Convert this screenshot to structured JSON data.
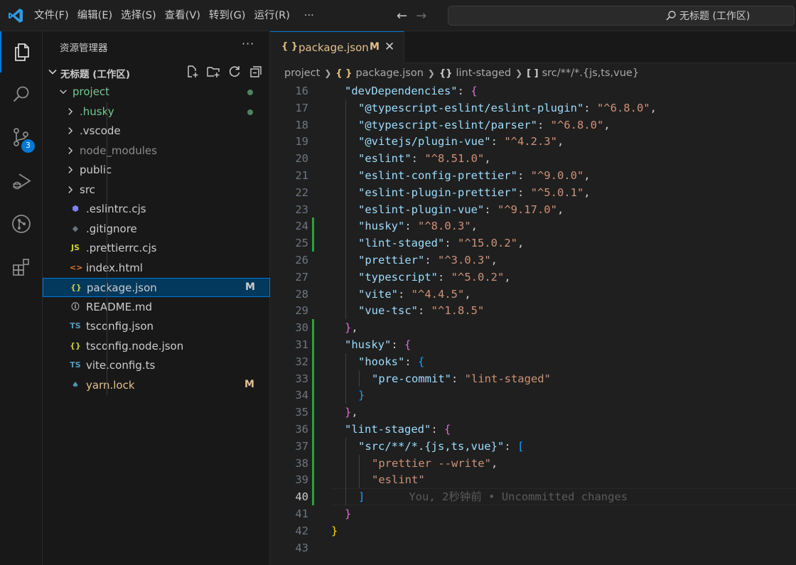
{
  "menu": {
    "items": [
      "文件(F)",
      "编辑(E)",
      "选择(S)",
      "查看(V)",
      "转到(G)",
      "运行(R)",
      "···"
    ],
    "search_text": "无标题 (工作区)"
  },
  "activity": {
    "scm_badge": "3"
  },
  "sidebar": {
    "title": "资源管理器",
    "more": "···",
    "workspace": "无标题 (工作区)",
    "tree": [
      {
        "label": "project",
        "type": "folder-open",
        "indent": 0,
        "color": "#73c991",
        "dot": true
      },
      {
        "label": ".husky",
        "type": "folder",
        "indent": 1,
        "color": "#73c991",
        "dot": true
      },
      {
        "label": ".vscode",
        "type": "folder",
        "indent": 1,
        "color": "#cccccc"
      },
      {
        "label": "node_modules",
        "type": "folder",
        "indent": 1,
        "color": "#8c8c8c"
      },
      {
        "label": "public",
        "type": "folder",
        "indent": 1,
        "color": "#cccccc"
      },
      {
        "label": "src",
        "type": "folder",
        "indent": 1,
        "color": "#cccccc"
      },
      {
        "label": ".eslintrc.cjs",
        "type": "file",
        "indent": 1,
        "icon": "eslint",
        "color": "#cccccc"
      },
      {
        "label": ".gitignore",
        "type": "file",
        "indent": 1,
        "icon": "git",
        "color": "#cccccc"
      },
      {
        "label": ".prettierrc.cjs",
        "type": "file",
        "indent": 1,
        "icon": "js",
        "color": "#cccccc"
      },
      {
        "label": "index.html",
        "type": "file",
        "indent": 1,
        "icon": "html",
        "color": "#cccccc"
      },
      {
        "label": "package.json",
        "type": "file",
        "indent": 1,
        "icon": "json",
        "color": "#cccccc",
        "status": "M",
        "selected": true
      },
      {
        "label": "README.md",
        "type": "file",
        "indent": 1,
        "icon": "info",
        "color": "#cccccc"
      },
      {
        "label": "tsconfig.json",
        "type": "file",
        "indent": 1,
        "icon": "tsconfig",
        "color": "#cccccc"
      },
      {
        "label": "tsconfig.node.json",
        "type": "file",
        "indent": 1,
        "icon": "json",
        "color": "#cccccc"
      },
      {
        "label": "vite.config.ts",
        "type": "file",
        "indent": 1,
        "icon": "ts",
        "color": "#cccccc"
      },
      {
        "label": "yarn.lock",
        "type": "file",
        "indent": 1,
        "icon": "yarn",
        "color": "#e2c08d",
        "status": "M"
      }
    ]
  },
  "editor": {
    "tab": {
      "label": "package.json",
      "status": "M",
      "close": "✕",
      "icon": "{ }"
    },
    "breadcrumb": {
      "project": "project",
      "file": "package.json",
      "obj": "lint-staged",
      "arr": "src/**/*.{js,ts,vue}"
    },
    "current_line": 40,
    "blame": "You, 2秒钟前 • Uncommitted changes",
    "modified_lines": [
      24,
      25,
      30,
      31,
      32,
      33,
      34,
      35,
      36,
      37,
      38,
      39,
      40
    ],
    "lines": [
      {
        "n": 16,
        "indent": 1,
        "tokens": [
          [
            "k",
            "\"devDependencies\""
          ],
          [
            "p",
            ": "
          ],
          [
            "b1",
            "{"
          ]
        ]
      },
      {
        "n": 17,
        "indent": 2,
        "tokens": [
          [
            "k",
            "\"@typescript-eslint/eslint-plugin\""
          ],
          [
            "p",
            ": "
          ],
          [
            "s",
            "\"^6.8.0\""
          ],
          [
            "p",
            ","
          ]
        ]
      },
      {
        "n": 18,
        "indent": 2,
        "tokens": [
          [
            "k",
            "\"@typescript-eslint/parser\""
          ],
          [
            "p",
            ": "
          ],
          [
            "s",
            "\"^6.8.0\""
          ],
          [
            "p",
            ","
          ]
        ]
      },
      {
        "n": 19,
        "indent": 2,
        "tokens": [
          [
            "k",
            "\"@vitejs/plugin-vue\""
          ],
          [
            "p",
            ": "
          ],
          [
            "s",
            "\"^4.2.3\""
          ],
          [
            "p",
            ","
          ]
        ]
      },
      {
        "n": 20,
        "indent": 2,
        "tokens": [
          [
            "k",
            "\"eslint\""
          ],
          [
            "p",
            ": "
          ],
          [
            "s",
            "\"^8.51.0\""
          ],
          [
            "p",
            ","
          ]
        ]
      },
      {
        "n": 21,
        "indent": 2,
        "tokens": [
          [
            "k",
            "\"eslint-config-prettier\""
          ],
          [
            "p",
            ": "
          ],
          [
            "s",
            "\"^9.0.0\""
          ],
          [
            "p",
            ","
          ]
        ]
      },
      {
        "n": 22,
        "indent": 2,
        "tokens": [
          [
            "k",
            "\"eslint-plugin-prettier\""
          ],
          [
            "p",
            ": "
          ],
          [
            "s",
            "\"^5.0.1\""
          ],
          [
            "p",
            ","
          ]
        ]
      },
      {
        "n": 23,
        "indent": 2,
        "tokens": [
          [
            "k",
            "\"eslint-plugin-vue\""
          ],
          [
            "p",
            ": "
          ],
          [
            "s",
            "\"^9.17.0\""
          ],
          [
            "p",
            ","
          ]
        ]
      },
      {
        "n": 24,
        "indent": 2,
        "tokens": [
          [
            "k",
            "\"husky\""
          ],
          [
            "p",
            ": "
          ],
          [
            "s",
            "\"^8.0.3\""
          ],
          [
            "p",
            ","
          ]
        ]
      },
      {
        "n": 25,
        "indent": 2,
        "tokens": [
          [
            "k",
            "\"lint-staged\""
          ],
          [
            "p",
            ": "
          ],
          [
            "s",
            "\"^15.0.2\""
          ],
          [
            "p",
            ","
          ]
        ]
      },
      {
        "n": 26,
        "indent": 2,
        "tokens": [
          [
            "k",
            "\"prettier\""
          ],
          [
            "p",
            ": "
          ],
          [
            "s",
            "\"^3.0.3\""
          ],
          [
            "p",
            ","
          ]
        ]
      },
      {
        "n": 27,
        "indent": 2,
        "tokens": [
          [
            "k",
            "\"typescript\""
          ],
          [
            "p",
            ": "
          ],
          [
            "s",
            "\"^5.0.2\""
          ],
          [
            "p",
            ","
          ]
        ]
      },
      {
        "n": 28,
        "indent": 2,
        "tokens": [
          [
            "k",
            "\"vite\""
          ],
          [
            "p",
            ": "
          ],
          [
            "s",
            "\"^4.4.5\""
          ],
          [
            "p",
            ","
          ]
        ]
      },
      {
        "n": 29,
        "indent": 2,
        "tokens": [
          [
            "k",
            "\"vue-tsc\""
          ],
          [
            "p",
            ": "
          ],
          [
            "s",
            "\"^1.8.5\""
          ]
        ]
      },
      {
        "n": 30,
        "indent": 1,
        "tokens": [
          [
            "b1",
            "}"
          ],
          [
            "p",
            ","
          ]
        ]
      },
      {
        "n": 31,
        "indent": 1,
        "tokens": [
          [
            "k",
            "\"husky\""
          ],
          [
            "p",
            ": "
          ],
          [
            "b1",
            "{"
          ]
        ]
      },
      {
        "n": 32,
        "indent": 2,
        "tokens": [
          [
            "k",
            "\"hooks\""
          ],
          [
            "p",
            ": "
          ],
          [
            "b2",
            "{"
          ]
        ]
      },
      {
        "n": 33,
        "indent": 3,
        "tokens": [
          [
            "k",
            "\"pre-commit\""
          ],
          [
            "p",
            ": "
          ],
          [
            "s",
            "\"lint-staged\""
          ]
        ]
      },
      {
        "n": 34,
        "indent": 2,
        "tokens": [
          [
            "b2",
            "}"
          ]
        ]
      },
      {
        "n": 35,
        "indent": 1,
        "tokens": [
          [
            "b1",
            "}"
          ],
          [
            "p",
            ","
          ]
        ]
      },
      {
        "n": 36,
        "indent": 1,
        "tokens": [
          [
            "k",
            "\"lint-staged\""
          ],
          [
            "p",
            ": "
          ],
          [
            "b1",
            "{"
          ]
        ]
      },
      {
        "n": 37,
        "indent": 2,
        "tokens": [
          [
            "k",
            "\"src/**/*.{js,ts,vue}\""
          ],
          [
            "p",
            ": "
          ],
          [
            "b2",
            "["
          ]
        ]
      },
      {
        "n": 38,
        "indent": 3,
        "tokens": [
          [
            "s",
            "\"prettier --write\""
          ],
          [
            "p",
            ","
          ]
        ]
      },
      {
        "n": 39,
        "indent": 3,
        "tokens": [
          [
            "s",
            "\"eslint\""
          ]
        ]
      },
      {
        "n": 40,
        "indent": 2,
        "tokens": [
          [
            "b2",
            "]"
          ]
        ]
      },
      {
        "n": 41,
        "indent": 1,
        "tokens": [
          [
            "b1",
            "}"
          ]
        ]
      },
      {
        "n": 42,
        "indent": 0,
        "tokens": [
          [
            "b3",
            "}"
          ]
        ]
      },
      {
        "n": 43,
        "indent": 0,
        "tokens": []
      }
    ]
  }
}
